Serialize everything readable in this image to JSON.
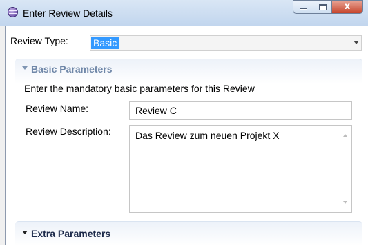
{
  "window": {
    "title": "Enter Review Details",
    "close_glyph": "x"
  },
  "review_type": {
    "label": "Review Type:",
    "value": "Basic"
  },
  "basic_section": {
    "title": "Basic Parameters",
    "description": "Enter the mandatory basic parameters for this Review",
    "name_label": "Review Name:",
    "name_value": "Review C",
    "desc_label": "Review Description:",
    "desc_value": "Das Review zum neuen Projekt X"
  },
  "extra_section": {
    "title": "Extra Parameters"
  },
  "icons": {
    "app": "review-app-icon",
    "minimize": "minimize-icon",
    "maximize": "maximize-icon",
    "close": "close-icon",
    "dropdown": "chevron-down-icon",
    "collapse": "triangle-down-icon"
  },
  "colors": {
    "selection": "#3399ff",
    "section_title": "#6f87a8",
    "close_button": "#c6452c"
  }
}
